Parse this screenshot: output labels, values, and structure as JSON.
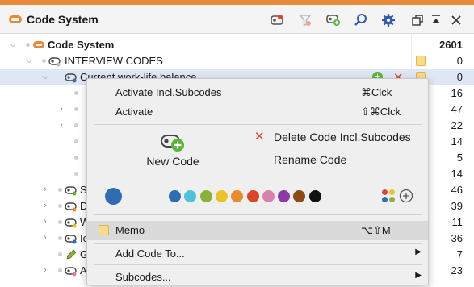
{
  "header": {
    "title": "Code System",
    "accent": "#e8893a",
    "toolbar_icons": [
      "new-code-set-icon",
      "filter-icon",
      "add-code-icon",
      "search-icon",
      "settings-icon",
      "undock-icon",
      "collapse-icon",
      "close-icon"
    ]
  },
  "tree": {
    "rows": [
      {
        "label": "Code System",
        "count": "2601"
      },
      {
        "label": "INTERVIEW CODES",
        "count": "0"
      },
      {
        "label": "Current work-life balance",
        "count": "0"
      },
      {
        "label": "",
        "count": "16"
      },
      {
        "label": "",
        "count": "47"
      },
      {
        "label": "",
        "count": "22"
      },
      {
        "label": "",
        "count": "14"
      },
      {
        "label": "",
        "count": "5"
      },
      {
        "label": "",
        "count": "14"
      },
      {
        "label": "S",
        "count": "46"
      },
      {
        "label": "D",
        "count": "39"
      },
      {
        "label": "W",
        "count": "11"
      },
      {
        "label": "Ic",
        "count": "36"
      },
      {
        "label": "G",
        "count": "7"
      },
      {
        "label": "A",
        "count": "23"
      }
    ]
  },
  "context_menu": {
    "activate_incl_subcodes": "Activate Incl.Subcodes",
    "activate_incl_subcodes_shortcut": "⌘Clck",
    "activate": "Activate",
    "activate_shortcut": "⇧⌘Clck",
    "new_code": "New Code",
    "delete_code": "Delete Code Incl.Subcodes",
    "rename_code": "Rename Code",
    "current_color": "#2e6db4",
    "colors": [
      "#2e6db4",
      "#4cc3d6",
      "#8bb13c",
      "#eac32c",
      "#e88a2e",
      "#d9472b",
      "#d97fae",
      "#8e3aa6",
      "#8a4b16",
      "#111111"
    ],
    "memo": "Memo",
    "memo_shortcut": "⌥⇧M",
    "add_code_to": "Add Code To...",
    "subcodes": "Subcodes..."
  }
}
